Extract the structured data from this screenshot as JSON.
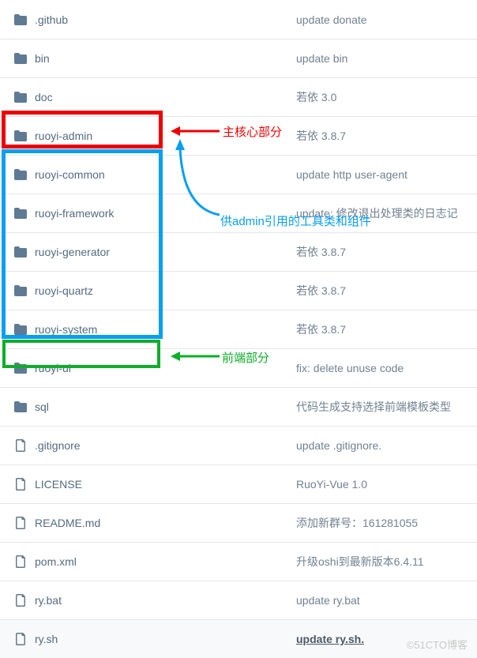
{
  "files": [
    {
      "type": "folder",
      "name": ".github",
      "message": "update donate"
    },
    {
      "type": "folder",
      "name": "bin",
      "message": "update bin"
    },
    {
      "type": "folder",
      "name": "doc",
      "message": "若依 3.0"
    },
    {
      "type": "folder",
      "name": "ruoyi-admin",
      "message": "若依 3.8.7"
    },
    {
      "type": "folder",
      "name": "ruoyi-common",
      "message": "update http user-agent"
    },
    {
      "type": "folder",
      "name": "ruoyi-framework",
      "message": "update: 修改退出处理类的日志记"
    },
    {
      "type": "folder",
      "name": "ruoyi-generator",
      "message": "若依 3.8.7"
    },
    {
      "type": "folder",
      "name": "ruoyi-quartz",
      "message": "若依 3.8.7"
    },
    {
      "type": "folder",
      "name": "ruoyi-system",
      "message": "若依 3.8.7"
    },
    {
      "type": "folder",
      "name": "ruoyi-ui",
      "message": "fix: delete unuse code"
    },
    {
      "type": "folder",
      "name": "sql",
      "message": "代码生成支持选择前端模板类型"
    },
    {
      "type": "file",
      "name": ".gitignore",
      "message": "update .gitignore."
    },
    {
      "type": "file",
      "name": "LICENSE",
      "message": "RuoYi-Vue 1.0"
    },
    {
      "type": "file",
      "name": "README.md",
      "message": "添加新群号：161281055"
    },
    {
      "type": "file",
      "name": "pom.xml",
      "message": "升级oshi到最新版本6.4.11"
    },
    {
      "type": "file",
      "name": "ry.bat",
      "message": "update ry.bat"
    },
    {
      "type": "file",
      "name": "ry.sh",
      "message": "update ry.sh.",
      "underline": true
    }
  ],
  "annotations": {
    "red": "主核心部分",
    "blue": "供admin引用的工具类和组件",
    "green": "前端部分"
  },
  "watermark": "©51CTO博客"
}
